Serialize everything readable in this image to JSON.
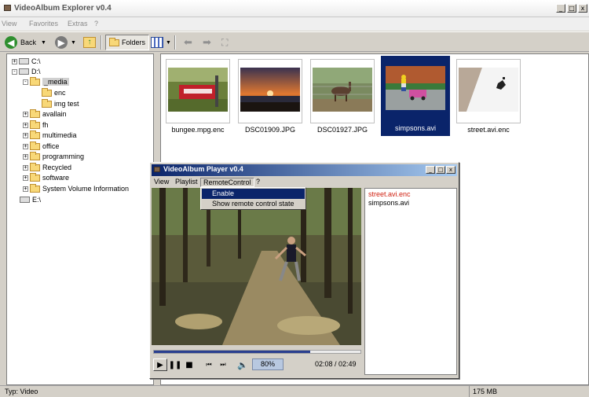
{
  "explorer": {
    "title": "VideoAlbum Explorer v0.4",
    "menu": [
      "View",
      "Favorites",
      "Extras",
      "?"
    ],
    "toolbar": {
      "back_label": "Back",
      "folders_label": "Folders"
    },
    "tree": [
      {
        "label": "C:\\",
        "expander": "+",
        "kind": "drive"
      },
      {
        "label": "D:\\",
        "expander": "-",
        "kind": "drive"
      },
      {
        "label": "_media",
        "expander": "-",
        "kind": "folder",
        "selected": true
      },
      {
        "label": "enc",
        "expander": "",
        "kind": "folder"
      },
      {
        "label": "img test",
        "expander": "",
        "kind": "folder"
      },
      {
        "label": "avallain",
        "expander": "+",
        "kind": "folder"
      },
      {
        "label": "fh",
        "expander": "+",
        "kind": "folder"
      },
      {
        "label": "multimedia",
        "expander": "+",
        "kind": "folder"
      },
      {
        "label": "office",
        "expander": "+",
        "kind": "folder"
      },
      {
        "label": "programming",
        "expander": "+",
        "kind": "folder"
      },
      {
        "label": "Recycled",
        "expander": "+",
        "kind": "folder"
      },
      {
        "label": "software",
        "expander": "+",
        "kind": "folder"
      },
      {
        "label": "System Volume Information",
        "expander": "+",
        "kind": "folder"
      },
      {
        "label": "E:\\",
        "expander": "",
        "kind": "drive"
      }
    ],
    "thumbnails": [
      {
        "label": "bungee.mpg.enc",
        "selected": false
      },
      {
        "label": "DSC01909.JPG",
        "selected": false
      },
      {
        "label": "DSC01927.JPG",
        "selected": false
      },
      {
        "label": "simpsons.avi",
        "selected": true
      },
      {
        "label": "street.avi.enc",
        "selected": false
      }
    ],
    "status": {
      "left": "Typ: Video",
      "right": "175 MB"
    }
  },
  "player": {
    "title": "VideoAlbum Player v0.4",
    "menu": [
      "View",
      "Playlist",
      "RemoteControl",
      "?"
    ],
    "active_menu": "RemoteControl",
    "dropdown": [
      "Enable",
      "Show remote control state"
    ],
    "dropdown_highlighted": "Enable",
    "volume": "80%",
    "time": "02:08 / 02:49",
    "progress_fraction": 0.755,
    "playlist": [
      {
        "label": "street.avi.enc",
        "active": true
      },
      {
        "label": "simpsons.avi",
        "active": false
      }
    ]
  },
  "colors": {
    "selection": "#0a246a",
    "playlist_active": "#d02010"
  }
}
